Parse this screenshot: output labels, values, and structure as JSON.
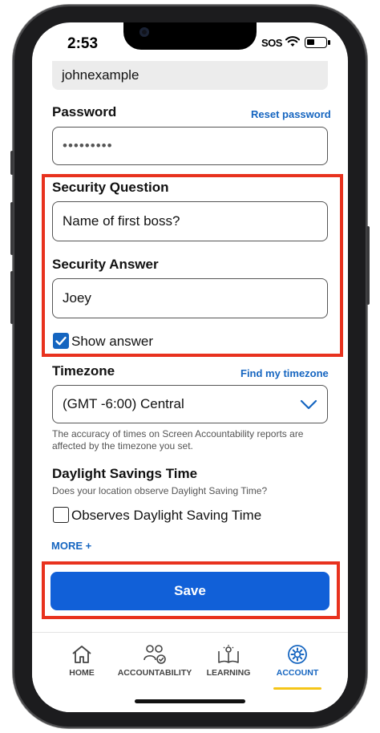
{
  "status_bar": {
    "time": "2:53",
    "sos": "SOS"
  },
  "form": {
    "username_value": "johnexample",
    "password": {
      "label": "Password",
      "reset_link": "Reset password",
      "value": "•••••••••"
    },
    "security_question": {
      "label": "Security Question",
      "value": "Name of first boss?"
    },
    "security_answer": {
      "label": "Security Answer",
      "value": "Joey"
    },
    "show_answer": {
      "label": "Show answer",
      "checked": true
    },
    "timezone": {
      "label": "Timezone",
      "find_link": "Find my timezone",
      "selected": "(GMT -6:00) Central",
      "help": "The accuracy of times on Screen Accountability reports are affected by the timezone you set."
    },
    "dst": {
      "label": "Daylight Savings Time",
      "help": "Does your location observe Daylight Saving Time?",
      "checkbox_label": "Observes Daylight Saving Time",
      "checked": false
    },
    "more_link": "MORE +",
    "save_label": "Save"
  },
  "tabbar": {
    "items": [
      {
        "label": "HOME",
        "icon": "home-icon"
      },
      {
        "label": "ACCOUNTABILITY",
        "icon": "accountability-icon"
      },
      {
        "label": "LEARNING",
        "icon": "learning-icon"
      },
      {
        "label": "ACCOUNT",
        "icon": "gear-icon",
        "active": true
      }
    ]
  },
  "colors": {
    "accent": "#1160d8",
    "link": "#1565c0",
    "highlight": "#e8321e",
    "tab_underline": "#f5c518"
  }
}
